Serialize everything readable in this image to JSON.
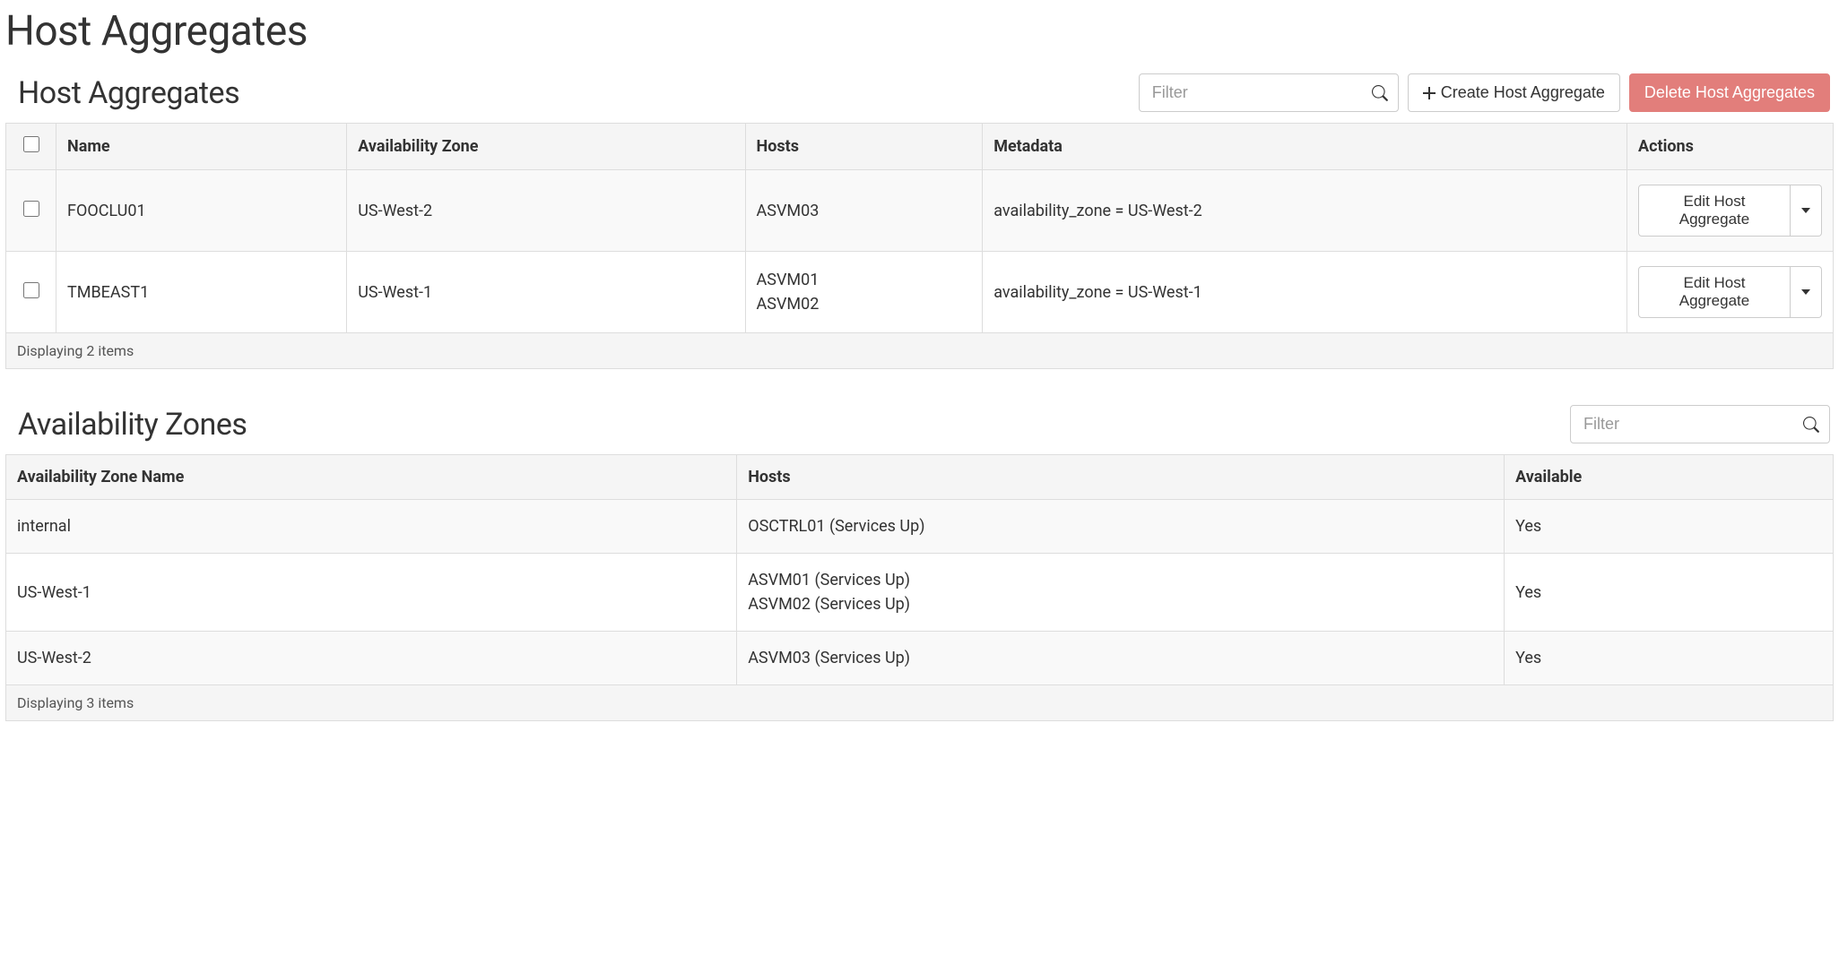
{
  "page": {
    "title": "Host Aggregates"
  },
  "aggregates": {
    "title": "Host Aggregates",
    "filter_placeholder": "Filter",
    "create_label": "Create Host Aggregate",
    "delete_label": "Delete Host Aggregates",
    "columns": {
      "name": "Name",
      "az": "Availability Zone",
      "hosts": "Hosts",
      "metadata": "Metadata",
      "actions": "Actions"
    },
    "edit_label": "Edit Host Aggregate",
    "rows": [
      {
        "name": "FOOCLU01",
        "az": "US-West-2",
        "hosts": "ASVM03",
        "metadata": "availability_zone = US-West-2"
      },
      {
        "name": "TMBEAST1",
        "az": "US-West-1",
        "hosts": "ASVM01\nASVM02",
        "metadata": "availability_zone = US-West-1"
      }
    ],
    "footer": "Displaying 2 items"
  },
  "zones": {
    "title": "Availability Zones",
    "filter_placeholder": "Filter",
    "columns": {
      "name": "Availability Zone Name",
      "hosts": "Hosts",
      "available": "Available"
    },
    "rows": [
      {
        "name": "internal",
        "hosts": "OSCTRL01 (Services Up)",
        "available": "Yes"
      },
      {
        "name": "US-West-1",
        "hosts": "ASVM01 (Services Up)\nASVM02 (Services Up)",
        "available": "Yes"
      },
      {
        "name": "US-West-2",
        "hosts": "ASVM03 (Services Up)",
        "available": "Yes"
      }
    ],
    "footer": "Displaying 3 items"
  }
}
